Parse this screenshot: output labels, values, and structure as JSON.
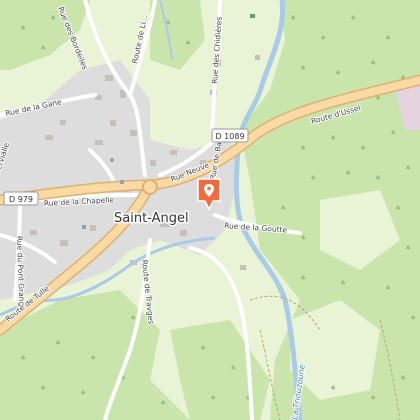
{
  "map": {
    "town_name": "Saint-Angel",
    "road_shields": [
      {
        "id": "d1089",
        "text": "D 1089"
      },
      {
        "id": "d979",
        "text": "D 979"
      }
    ],
    "streets": {
      "rue_des_bordeiles": "Rue des Bordeiles",
      "route_de_lig": "Route de Li...",
      "rue_des_chidieres": "Rue des Chidières",
      "rue_de_la_gane": "Rue de la Gane",
      "route_dussel": "Route d'Ussel",
      "rue_neuve": "Rue Neuve",
      "rue_de_la_chapelle": "Rue de la Chapelle",
      "rue_de_barry": "Rue de Barry",
      "rue_de_la_goutte": "Rue de la Goutte",
      "rue_du_pont_grange": "Rue du Pont Grange",
      "route_de_tulle": "Route de Tulle",
      "route_de_travges": "Route de Travges",
      "lervialle": "lervialle"
    },
    "water": {
      "la_triouzoune": "La Triouzoune"
    },
    "marker": {
      "icon": "map-pin-icon",
      "color": "#f26a3d"
    },
    "colors": {
      "background": "#e9f3d6",
      "forest": "#c9e5ac",
      "village": "#dddddd",
      "major_road": "#f9d9a4",
      "river": "#a8cbe8"
    }
  }
}
